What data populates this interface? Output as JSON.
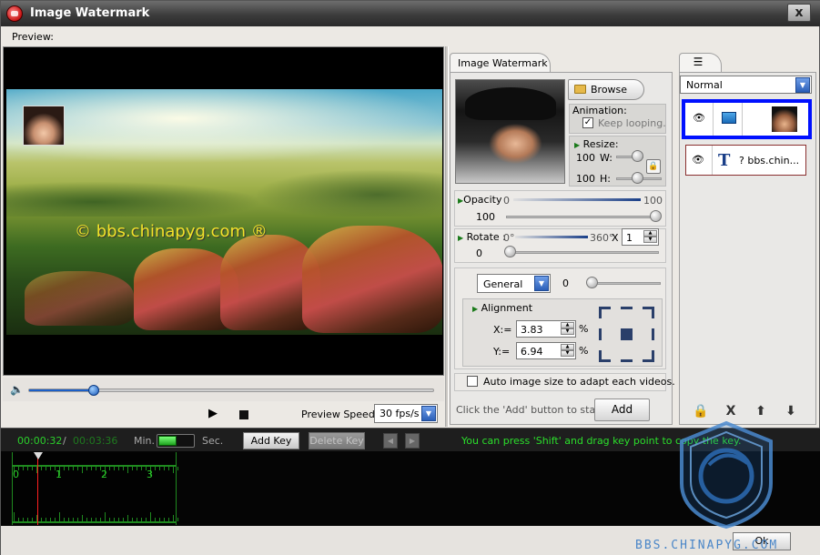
{
  "window": {
    "title": "Image Watermark",
    "close_label": "x"
  },
  "preview": {
    "label": "Preview:",
    "overlay_text": "© bbs.chinapyg.com ®",
    "seek_progress": 0.16,
    "speed_label": "Preview Speed:",
    "speed_value": "30 fps/s"
  },
  "watermark_panel": {
    "tab_label": "Image Watermark",
    "browse_label": "Browse",
    "animation_label": "Animation:",
    "keep_looping_label": "Keep looping.",
    "keep_looping_checked": true,
    "resize_label": "Resize:",
    "width_value": "100",
    "width_label": "W:",
    "height_value": "100",
    "height_label": "H:",
    "opacity_label": "Opacity",
    "opacity_min": "0",
    "opacity_max": "100",
    "opacity_value": "100",
    "rotate_label": "Rotate",
    "rotate_min": "0°",
    "rotate_max": "360°",
    "rotate_multiplier_symbol": "X",
    "rotate_multiplier_value": "1",
    "rotate_value": "0",
    "general_select": "General",
    "general_value": "0",
    "alignment_label": "Alignment",
    "x_label": "X:=",
    "x_value": "3.83",
    "y_label": "Y:=",
    "y_value": "6.94",
    "percent_symbol": "%",
    "auto_size_label": "Auto image size to adapt each videos.",
    "add_hint": "Click the 'Add' button to start ->",
    "add_label": "Add"
  },
  "layers_panel": {
    "blend_mode": "Normal",
    "layers": [
      {
        "type": "image",
        "label": ""
      },
      {
        "type": "text",
        "label": "? bbs.chin..."
      }
    ],
    "buttons": [
      "lock",
      "X",
      "up",
      "down"
    ]
  },
  "timeline": {
    "current_time": "00:00:32",
    "separator": "/",
    "total_time": "00:03:36",
    "min_label": "Min.",
    "sec_label": "Sec.",
    "add_key_label": "Add Key",
    "delete_key_label": "Delete Key",
    "hint": "You can press 'Shift' and drag key point to copy the key.",
    "ruler_labels": [
      "0",
      "1",
      "2",
      "3"
    ]
  },
  "footer": {
    "ok_label": "Ok",
    "logo_text": "BBS.CHINAPYG.COM"
  },
  "colors": {
    "selected_layer_border": "#0010ff",
    "timeline_green": "#2bcf2b",
    "seek_blue": "#1b5fc7",
    "playhead_red": "#ff2020"
  }
}
